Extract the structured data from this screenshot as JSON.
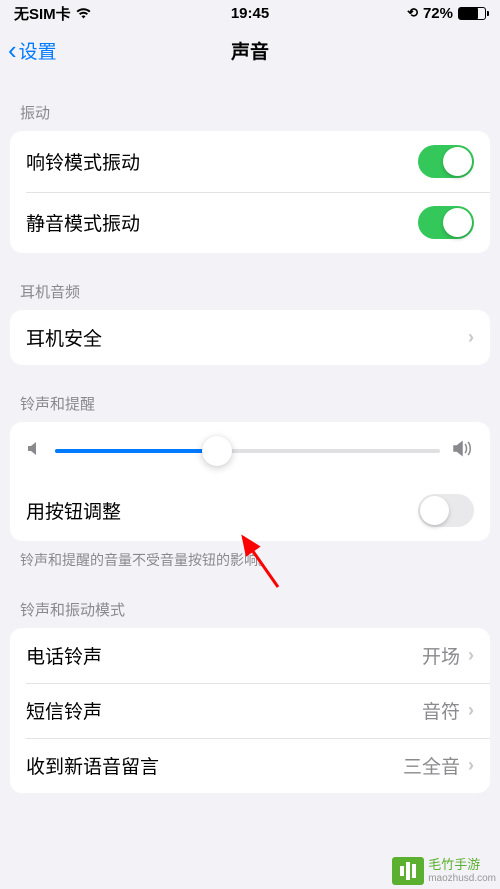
{
  "statusBar": {
    "carrier": "无SIM卡",
    "time": "19:45",
    "batteryPercent": "72%",
    "batteryLevel": 72
  },
  "nav": {
    "back": "设置",
    "title": "声音"
  },
  "sections": {
    "vibration": {
      "header": "振动",
      "ringVibrate": {
        "label": "响铃模式振动",
        "on": true
      },
      "silentVibrate": {
        "label": "静音模式振动",
        "on": true
      }
    },
    "headphone": {
      "header": "耳机音频",
      "safety": {
        "label": "耳机安全"
      }
    },
    "ringer": {
      "header": "铃声和提醒",
      "sliderPercent": 42,
      "buttonAdjust": {
        "label": "用按钮调整",
        "on": false
      },
      "footer": "铃声和提醒的音量不受音量按钮的影响。"
    },
    "patterns": {
      "header": "铃声和振动模式",
      "ringtone": {
        "label": "电话铃声",
        "value": "开场"
      },
      "texttone": {
        "label": "短信铃声",
        "value": "音符"
      },
      "voicemail": {
        "label": "收到新语音留言",
        "value": "三全音"
      }
    }
  },
  "watermark": {
    "name": "毛竹手游",
    "url": "maozhusd.com"
  }
}
